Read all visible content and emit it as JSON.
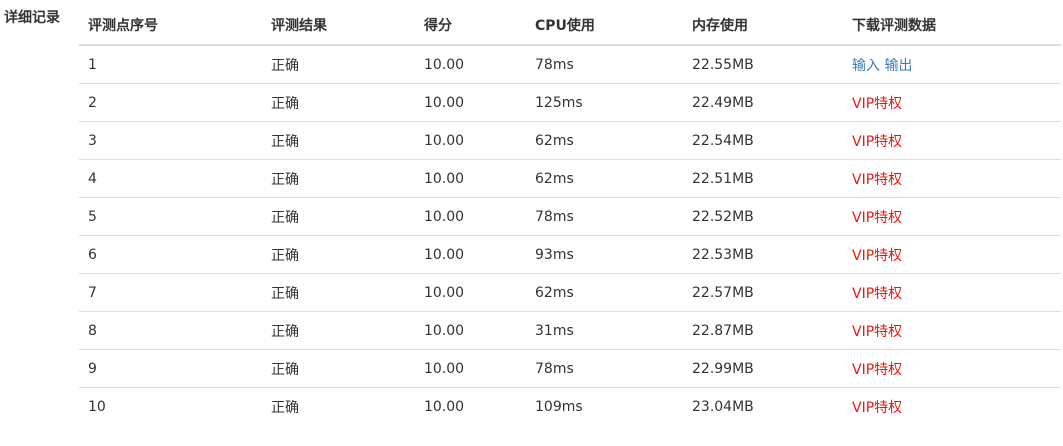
{
  "section": {
    "label": "详细记录"
  },
  "table": {
    "headers": [
      "评测点序号",
      "评测结果",
      "得分",
      "CPU使用",
      "内存使用",
      "下载评测数据"
    ],
    "rows": [
      {
        "id": "1",
        "result": "正确",
        "score": "10.00",
        "cpu": "78ms",
        "mem": "22.55MB",
        "download": {
          "type": "io",
          "input": "输入",
          "output": "输出"
        }
      },
      {
        "id": "2",
        "result": "正确",
        "score": "10.00",
        "cpu": "125ms",
        "mem": "22.49MB",
        "download": {
          "type": "vip",
          "label": "VIP特权"
        }
      },
      {
        "id": "3",
        "result": "正确",
        "score": "10.00",
        "cpu": "62ms",
        "mem": "22.54MB",
        "download": {
          "type": "vip",
          "label": "VIP特权"
        }
      },
      {
        "id": "4",
        "result": "正确",
        "score": "10.00",
        "cpu": "62ms",
        "mem": "22.51MB",
        "download": {
          "type": "vip",
          "label": "VIP特权"
        }
      },
      {
        "id": "5",
        "result": "正确",
        "score": "10.00",
        "cpu": "78ms",
        "mem": "22.52MB",
        "download": {
          "type": "vip",
          "label": "VIP特权"
        }
      },
      {
        "id": "6",
        "result": "正确",
        "score": "10.00",
        "cpu": "93ms",
        "mem": "22.53MB",
        "download": {
          "type": "vip",
          "label": "VIP特权"
        }
      },
      {
        "id": "7",
        "result": "正确",
        "score": "10.00",
        "cpu": "62ms",
        "mem": "22.57MB",
        "download": {
          "type": "vip",
          "label": "VIP特权"
        }
      },
      {
        "id": "8",
        "result": "正确",
        "score": "10.00",
        "cpu": "31ms",
        "mem": "22.87MB",
        "download": {
          "type": "vip",
          "label": "VIP特权"
        }
      },
      {
        "id": "9",
        "result": "正确",
        "score": "10.00",
        "cpu": "78ms",
        "mem": "22.99MB",
        "download": {
          "type": "vip",
          "label": "VIP特权"
        }
      },
      {
        "id": "10",
        "result": "正确",
        "score": "10.00",
        "cpu": "109ms",
        "mem": "23.04MB",
        "download": {
          "type": "vip",
          "label": "VIP特权"
        }
      }
    ]
  },
  "colors": {
    "text": "#333333",
    "link": "#3a7bbf",
    "vip": "#e8190c",
    "border": "#dddddd"
  }
}
